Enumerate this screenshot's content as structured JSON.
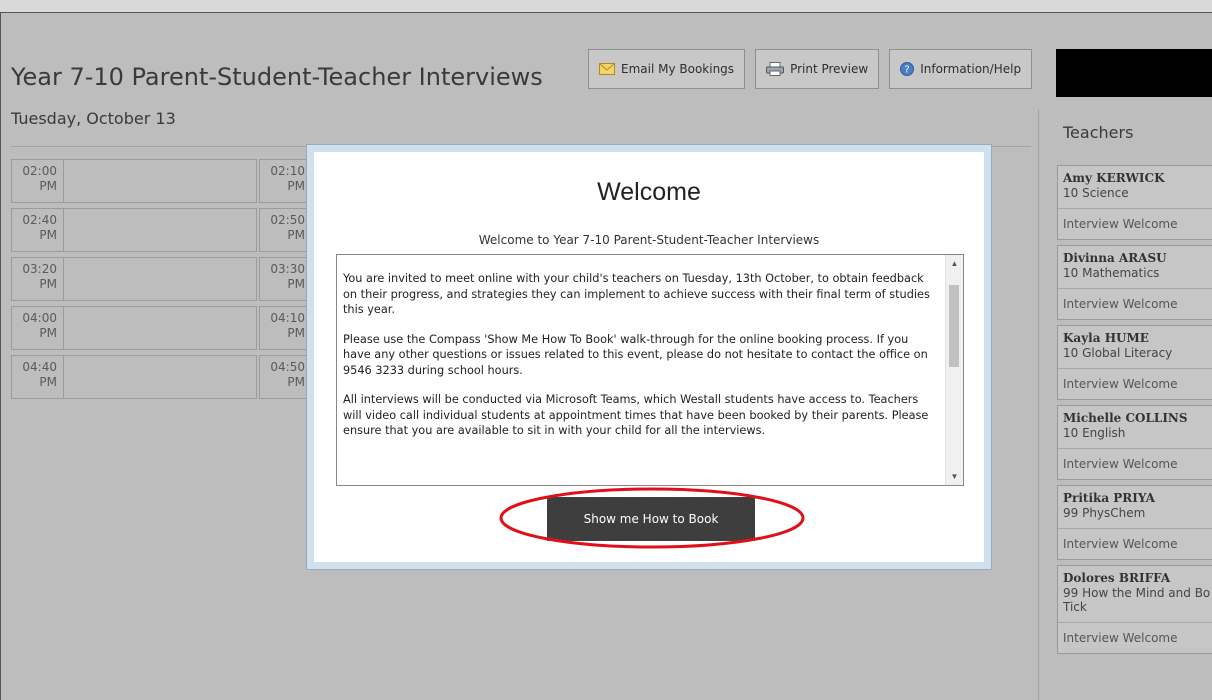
{
  "page": {
    "title": "Year 7-10 Parent-Student-Teacher Interviews",
    "date": "Tuesday, October 13"
  },
  "toolbar": {
    "email_label": "Email My Bookings",
    "print_label": "Print Preview",
    "help_label": "Information/Help"
  },
  "slots": [
    [
      {
        "hour": "02:00",
        "ampm": "PM"
      },
      {
        "hour": "02:10",
        "ampm": "PM"
      }
    ],
    [
      {
        "hour": "02:40",
        "ampm": "PM"
      },
      {
        "hour": "02:50",
        "ampm": "PM"
      }
    ],
    [
      {
        "hour": "03:20",
        "ampm": "PM"
      },
      {
        "hour": "03:30",
        "ampm": "PM"
      }
    ],
    [
      {
        "hour": "04:00",
        "ampm": "PM"
      },
      {
        "hour": "04:10",
        "ampm": "PM"
      }
    ],
    [
      {
        "hour": "04:40",
        "ampm": "PM"
      },
      {
        "hour": "04:50",
        "ampm": "PM"
      }
    ]
  ],
  "sidebar": {
    "title": "Teachers",
    "teachers": [
      {
        "name": "Amy KERWICK",
        "subject": "10 Science",
        "status": "Interview Welcome"
      },
      {
        "name": "Divinna ARASU",
        "subject": "10 Mathematics",
        "status": "Interview Welcome"
      },
      {
        "name": "Kayla HUME",
        "subject": "10 Global Literacy",
        "status": "Interview Welcome"
      },
      {
        "name": "Michelle COLLINS",
        "subject": "10 English",
        "status": "Interview Welcome"
      },
      {
        "name": "Pritika PRIYA",
        "subject": "99 PhysChem",
        "status": "Interview Welcome"
      },
      {
        "name": "Dolores BRIFFA",
        "subject": "99 How the Mind and Bo Tick",
        "status": "Interview Welcome"
      }
    ]
  },
  "modal": {
    "title": "Welcome",
    "subtitle": "Welcome to Year 7-10 Parent-Student-Teacher Interviews",
    "paragraphs": [
      "You are invited to meet online with your child's teachers on Tuesday, 13th October, to obtain feedback on their progress, and strategies they can implement to achieve success with their final term of studies this year.",
      "Please use the Compass 'Show Me How To Book' walk-through for the online booking process. If you have any other questions or issues related to this event, please do not hesitate to contact the office on 9546 3233 during school hours.",
      "All interviews will be conducted via Microsoft Teams, which Westall students have access to. Teachers will video call individual students at appointment times that have been booked by their parents. Please ensure that you are available to sit in with your child for all the interviews."
    ],
    "button_label": "Show me How to Book",
    "highlight_color": "#e0101a"
  }
}
